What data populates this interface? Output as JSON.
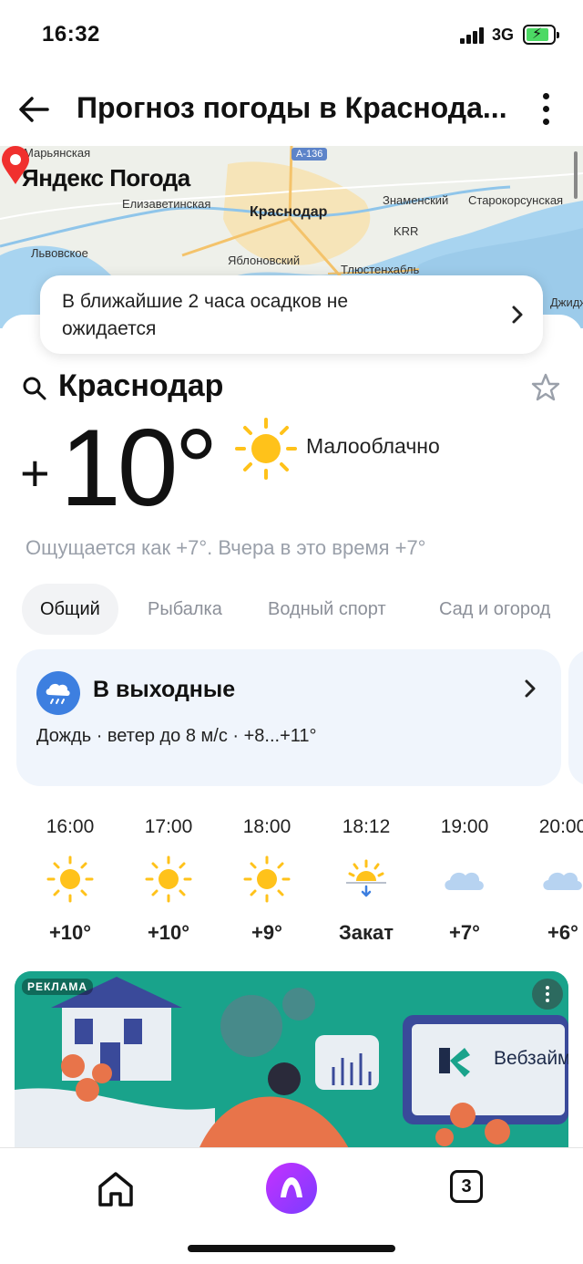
{
  "status_bar": {
    "time": "16:32",
    "network": "3G"
  },
  "header": {
    "title": "Прогноз погоды в Краснода..."
  },
  "map": {
    "brand": "Яндекс Погода",
    "city": "Краснодар",
    "road": "А-136",
    "places": [
      "Марьянская",
      "Елизаветинская",
      "Знаменский",
      "Старокорсунская",
      "Львовское",
      "Яблоновский",
      "Тлюстенхабль",
      "KRR",
      "Джидж"
    ]
  },
  "precipitation": {
    "text": "В ближайшие 2 часа осадков не ожидается"
  },
  "current": {
    "city": "Краснодар",
    "temp_sign": "+",
    "temp": "10°",
    "condition": "Малооблачно",
    "feels_like": "Ощущается как +7°. Вчера в это время +7°"
  },
  "tabs": [
    {
      "label": "Общий",
      "active": true
    },
    {
      "label": "Рыбалка",
      "active": false
    },
    {
      "label": "Водный спорт",
      "active": false
    },
    {
      "label": "Сад и огород",
      "active": false
    }
  ],
  "weekend": {
    "title": "В выходные",
    "description": "Дождь · ветер до 8 м/с · +8...+11°",
    "icon": "rain-cloud-icon"
  },
  "hourly": [
    {
      "time": "16:00",
      "icon": "sun",
      "temp": "+10°"
    },
    {
      "time": "17:00",
      "icon": "sun",
      "temp": "+10°"
    },
    {
      "time": "18:00",
      "icon": "sun",
      "temp": "+9°"
    },
    {
      "time": "18:12",
      "icon": "sunset",
      "temp": "Закат"
    },
    {
      "time": "19:00",
      "icon": "cloud",
      "temp": "+7°"
    },
    {
      "time": "20:00",
      "icon": "cloud",
      "temp": "+6°"
    }
  ],
  "ad": {
    "badge": "РЕКЛАМА",
    "brand": "Вебзайм"
  },
  "bottom_nav": {
    "tabs_count": "3"
  },
  "colors": {
    "accent": "#3d7fe0",
    "sun": "#ffc21a",
    "map_water": "#a8d4f0",
    "ad_bg": "#19a38b",
    "alice": "#a436ff"
  }
}
